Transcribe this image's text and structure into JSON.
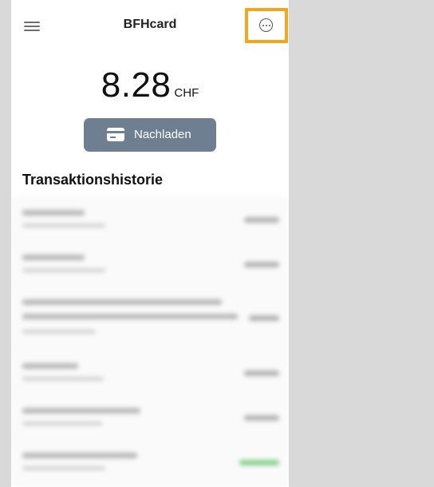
{
  "app": {
    "title": "BFHcard"
  },
  "balance": {
    "amount": "8.28",
    "currency": "CHF"
  },
  "actions": {
    "reload_label": "Nachladen"
  },
  "history": {
    "title": "Transaktionshistorie"
  },
  "icons": {
    "menu": "hamburger-menu-icon",
    "more": "more-options-icon",
    "card": "credit-card-icon"
  },
  "colors": {
    "highlight": "#f2a81d",
    "button": "#6f7f92",
    "positive_amount": "#86d08c"
  }
}
